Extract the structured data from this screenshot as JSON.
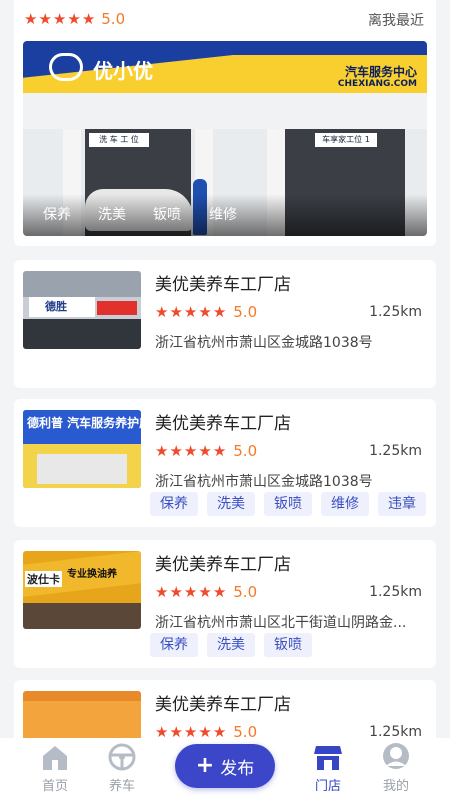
{
  "featured": {
    "rating": "5.0",
    "distance_label": "离我最近",
    "banner": {
      "brand": "优小优",
      "service_center": "汽车服务中心",
      "domain": "CHEXIANG.COM",
      "bay1_sign": "洗 车 工 位",
      "bay2_sign": "车享家工位 1"
    },
    "tags": [
      "保养",
      "洗美",
      "钣喷",
      "维修"
    ]
  },
  "shops": [
    {
      "name": "美优美养车工厂店",
      "rating": "5.0",
      "distance": "1.25km",
      "address": "浙江省杭州市萧山区金城路1038号",
      "thumb_text": "德胜",
      "tags": []
    },
    {
      "name": "美优美养车工厂店",
      "rating": "5.0",
      "distance": "1.25km",
      "address": "浙江省杭州市萧山区金城路1038号",
      "thumb_text": "德利普  汽车服务养护店",
      "tags": [
        "保养",
        "洗美",
        "钣喷",
        "维修",
        "违章"
      ]
    },
    {
      "name": "美优美养车工厂店",
      "rating": "5.0",
      "distance": "1.25km",
      "address": "浙江省杭州市萧山区北干街道山阴路金...",
      "thumb_text": "波仕卡",
      "thumb_text2": "专业换油养",
      "tags": [
        "保养",
        "洗美",
        "钣喷"
      ]
    },
    {
      "name": "美优美养车工厂店",
      "rating": "5.0",
      "distance": "1.25km",
      "address": "",
      "tags": []
    }
  ],
  "tabbar": {
    "home": "首页",
    "car": "养车",
    "publish": "发布",
    "stores": "门店",
    "mine": "我的"
  },
  "colors": {
    "accent": "#3c46c8",
    "star": "#f04a2c",
    "score": "#f47a2a",
    "chip_bg": "#eef1fb"
  }
}
